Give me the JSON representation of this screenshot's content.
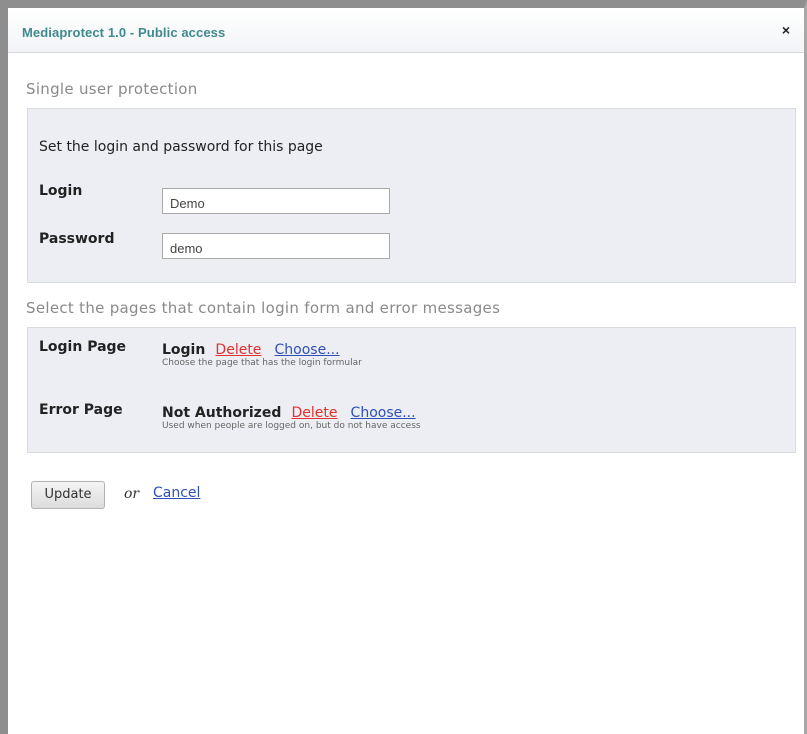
{
  "dialog": {
    "title": "Mediaprotect 1.0 - Public access",
    "close_symbol": "×"
  },
  "single_user": {
    "heading": "Single user protection",
    "intro": "Set the login and password for this page",
    "login_label": "Login",
    "login_value": "Demo",
    "password_label": "Password",
    "password_value": "demo"
  },
  "pages_section": {
    "heading": "Select the pages that contain login form and error messages",
    "login_page": {
      "label": "Login Page",
      "page": "Login",
      "delete_label": "Delete",
      "choose_label": "Choose...",
      "hint": "Choose the page that has the login formular"
    },
    "error_page": {
      "label": "Error Page",
      "page": "Not Authorized",
      "delete_label": "Delete",
      "choose_label": "Choose...",
      "hint": "Used when people are logged on, but do not have access"
    }
  },
  "actions": {
    "update_label": "Update",
    "or_text": "or",
    "cancel_label": "Cancel"
  }
}
